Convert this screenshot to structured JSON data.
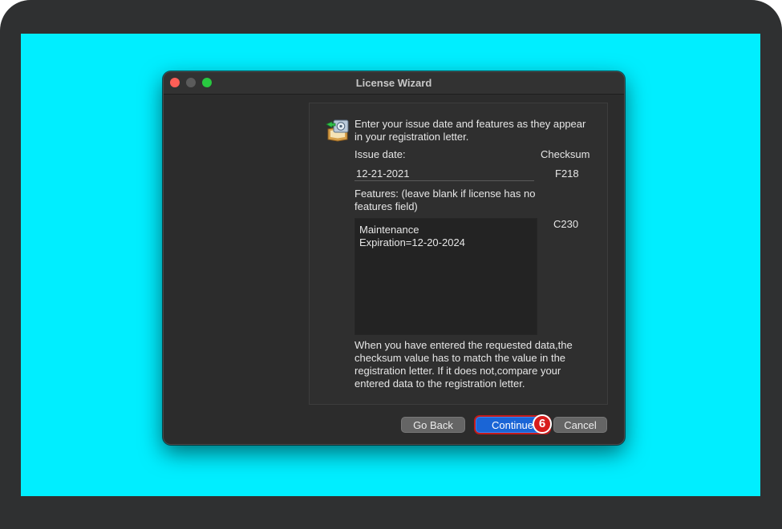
{
  "window": {
    "title": "License Wizard"
  },
  "panel": {
    "intro": "Enter your issue date and features as they appear in your registration letter.",
    "issue_date_label": "Issue date:",
    "checksum_label": "Checksum",
    "issue_date_value": "12-21-2021",
    "issue_date_checksum": "F218",
    "features_label": "Features: (leave blank if license has no features field)",
    "features_line1": "Maintenance",
    "features_line2": "Expiration=12-20-2024",
    "features_checksum": "C230",
    "help_text": "When you have entered the requested data,the checksum value has to match the value in the registration letter. If it does not,compare your entered data to the registration letter."
  },
  "buttons": {
    "go_back": "Go Back",
    "continue": "Continue",
    "cancel": "Cancel"
  },
  "step_badge": "6",
  "icons": [
    "license-app-icon"
  ],
  "colors": {
    "desktop_background": "#00eeff",
    "accent": "#1a65d6",
    "badge": "#d81b1b"
  }
}
